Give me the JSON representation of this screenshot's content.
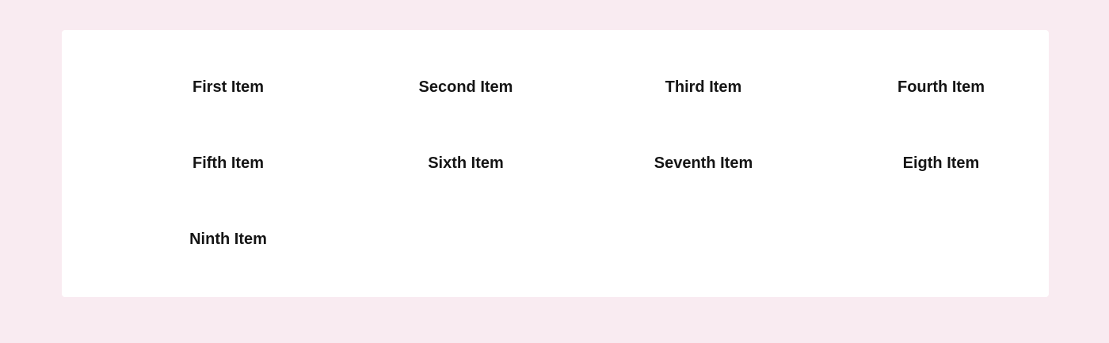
{
  "grid": {
    "items": [
      {
        "label": "First Item"
      },
      {
        "label": "Second Item"
      },
      {
        "label": "Third Item"
      },
      {
        "label": "Fourth Item"
      },
      {
        "label": "Fifth Item"
      },
      {
        "label": "Sixth Item"
      },
      {
        "label": "Seventh Item"
      },
      {
        "label": "Eigth Item"
      },
      {
        "label": "Ninth Item"
      }
    ]
  },
  "colors": {
    "page_background": "#f9ebf1",
    "card_background": "#ffffff",
    "text": "#151515"
  }
}
